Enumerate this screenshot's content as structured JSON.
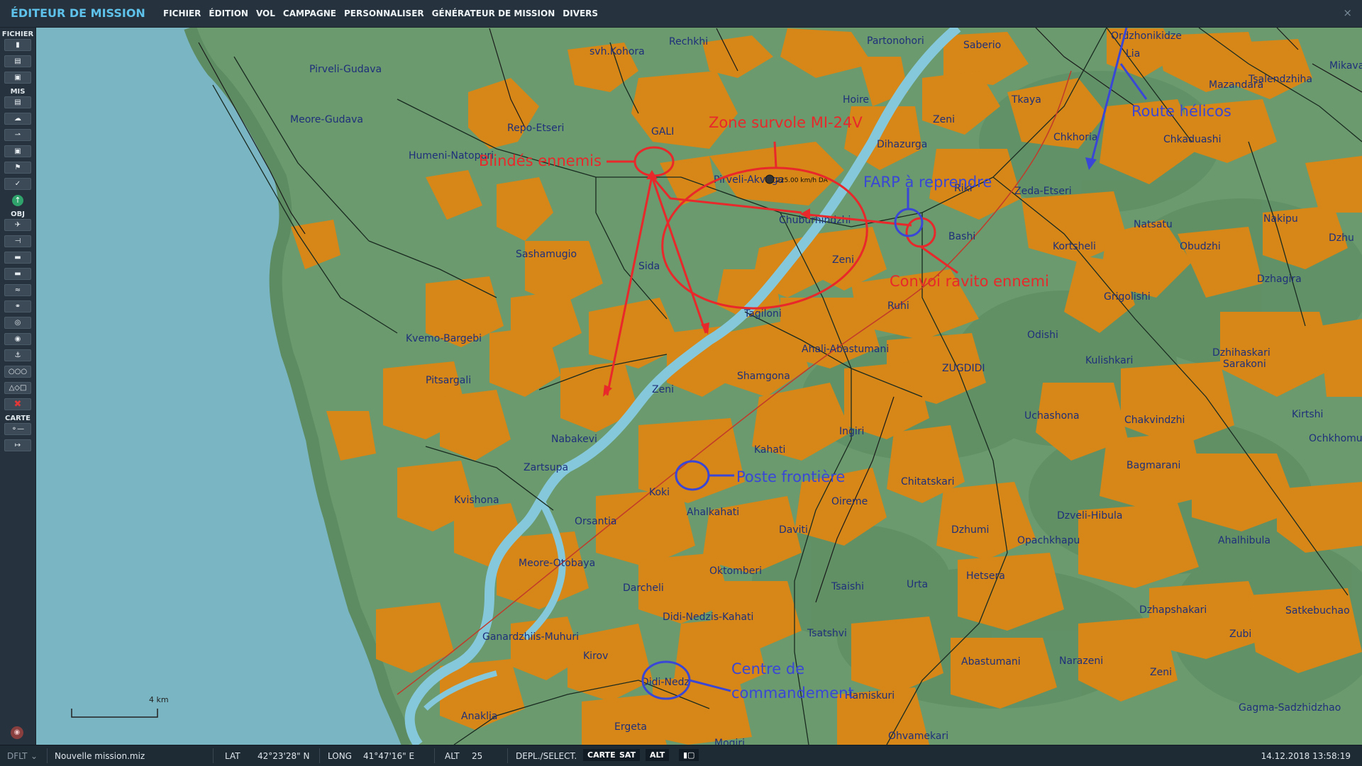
{
  "app": {
    "title": "ÉDITEUR DE MISSION",
    "close": "×"
  },
  "menu": [
    "FICHIER",
    "ÉDITION",
    "VOL",
    "CAMPAGNE",
    "PERSONNALISER",
    "GÉNÉRATEUR DE MISSION",
    "DIVERS"
  ],
  "sidebar": {
    "sections": {
      "fichier": "FICHIER",
      "mis": "MIS",
      "obj": "OBJ",
      "carte": "CARTE"
    },
    "fichier_icons": [
      "new-file-icon",
      "open-folder-icon",
      "save-icon"
    ],
    "mis_icons": [
      "briefing-icon",
      "weather-icon",
      "aircraft-group-icon",
      "trigger-icon",
      "flag-icon",
      "check-icon"
    ],
    "go_icon": "↑",
    "obj_icons": [
      "plane-icon",
      "helicopter-icon",
      "ship-icon",
      "tank-icon",
      "vehicles-icon",
      "static-icon",
      "target-icon",
      "zone-icon",
      "naval-icon",
      "triple-circle-icon",
      "shapes-icon",
      "delete-icon"
    ],
    "carte_icons": [
      "map-key-icon",
      "ruler-icon"
    ]
  },
  "map": {
    "colors": {
      "sea": "#7ab5c3",
      "land": "#6a9a6e",
      "urban": "#d68717",
      "river": "#86c8db",
      "annotation_red": "#e8282a",
      "annotation_blue": "#3a47d6"
    },
    "towns": [
      "Pirveli-Gudava",
      "Meore-Gudava",
      "svh.Kohora",
      "Rechkhi",
      "Partonohori",
      "Saberio",
      "Ordzhonikidze",
      "Lia",
      "Mikava",
      "Tsalendzhiha",
      "Mazandara",
      "Hoire",
      "Repo-Etseri",
      "GALI",
      "Humeni-Natopuri",
      "Zeni",
      "Dihazurga",
      "Tkaya",
      "Chkhoria",
      "Chkaduashi",
      "Pirveli-Akvaga",
      "Riki",
      "Zeda-Etseri",
      "Chuburhindzhi",
      "Natsatu",
      "Nakipu",
      "Dzhu",
      "Sashamugio",
      "Sida",
      "Zeni",
      "Bashi",
      "Kortsheli",
      "Obudzhi",
      "Dzhagira",
      "Ruhi",
      "Grigolishi",
      "Kvemo-Bargebi",
      "Tagiloni",
      "Odishi",
      "Ahali-Abastumani",
      "Dzhihaskari",
      "Pitsargali",
      "Shamgona",
      "ZUGDIDI",
      "Kulishkari",
      "Sarakoni",
      "Zeni",
      "Uchashona",
      "Kirtshi",
      "Nabakevi",
      "Ingiri",
      "Chakvindzhi",
      "Ochkhomu",
      "Kahati",
      "Zartsupa",
      "Bagmarani",
      "Kvishona",
      "Koki",
      "Chitatskari",
      "Oireme",
      "Ahalkahati",
      "Orsantia",
      "Dzveli-Hibula",
      "Daviti",
      "Dzhumi",
      "Opachkhapu",
      "Ahalhibula",
      "Meore-Otobaya",
      "Oktomberi",
      "Hetsera",
      "Darcheli",
      "Tsaishi",
      "Urta",
      "Dzhapshakari",
      "Satkebuchao",
      "Didi-Nedzis-Kahati",
      "Tsatshvi",
      "Zubi",
      "Ganardzhiis-Muhuri",
      "Kirov",
      "Abastumani",
      "Narazeni",
      "Zeni",
      "Didi-Nedz",
      "Hamiskuri",
      "Gagma-Sadzhidzhao",
      "Anaklia",
      "Ergeta",
      "Mogiri",
      "Ohvamekari"
    ],
    "unit_label": "225.00 km/h DA",
    "annotations": {
      "zone": "Zone survole MI-24V",
      "blindes": "Blindés ennemis",
      "farp": "FARP à reprendre",
      "convoi": "Convoi ravito ennemi",
      "route": "Route hélicos",
      "poste": "Poste frontière",
      "centre_line1": "Centre de",
      "centre_line2": "commandement"
    },
    "scale": "4 km"
  },
  "status": {
    "profile": "DFLT",
    "filename": "Nouvelle mission.miz",
    "lat_label": "LAT",
    "lat_value": "42°23'28\" N",
    "long_label": "LONG",
    "long_value": "41°47'16\" E",
    "alt_label": "ALT",
    "alt_value": "25",
    "mode_label": "DEPL./SELECT.",
    "btn_carte": "CARTE",
    "btn_sat": "SAT",
    "btn_alt": "ALT",
    "datetime": "14.12.2018 13:58:19"
  }
}
